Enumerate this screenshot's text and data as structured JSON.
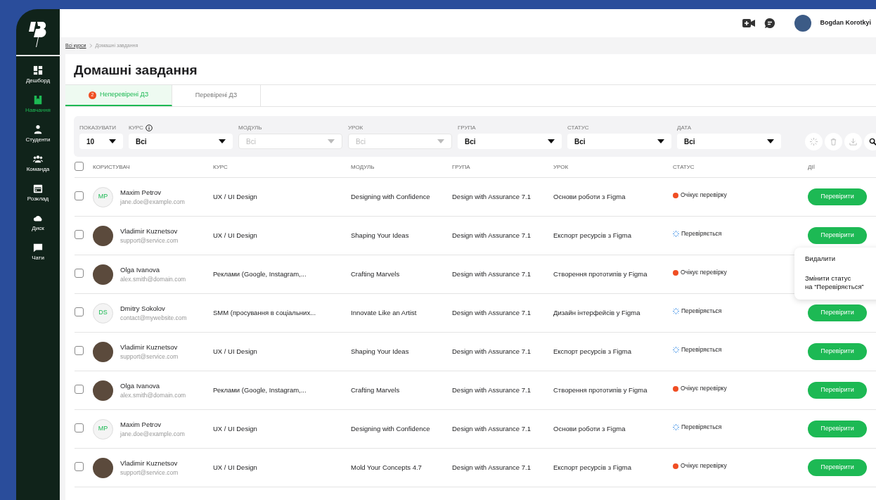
{
  "sidebar": {
    "items": [
      {
        "label": "Дешборд",
        "selected": false
      },
      {
        "label": "Навчання",
        "selected": true
      },
      {
        "label": "Студенти",
        "selected": false
      },
      {
        "label": "Команда",
        "selected": false
      },
      {
        "label": "Розклад",
        "selected": false
      },
      {
        "label": "Диск",
        "selected": false
      },
      {
        "label": "Чати",
        "selected": false
      }
    ]
  },
  "header": {
    "user_name": "Bogdan Korotkyi"
  },
  "breadcrumb": [
    "Всі курси",
    "Домашні завдання"
  ],
  "page_title": "Домашні завдання",
  "tabs": [
    {
      "label": "Неперевірені ДЗ",
      "badge": "2",
      "selected": true
    },
    {
      "label": "Перевірені ДЗ",
      "selected": false
    }
  ],
  "filters": [
    {
      "label": "ПОКАЗУВАТИ",
      "value": "10",
      "disabled": false,
      "info": false
    },
    {
      "label": "КУРС",
      "value": "Всі",
      "disabled": false,
      "info": true
    },
    {
      "label": "МОДУЛЬ",
      "value": "Всі",
      "disabled": true,
      "info": false
    },
    {
      "label": "УРОК",
      "value": "Всі",
      "disabled": true,
      "info": false
    },
    {
      "label": "ГРУПА",
      "value": "Всі",
      "disabled": false,
      "info": false
    },
    {
      "label": "СТАТУС",
      "value": "Всі",
      "disabled": false,
      "info": false
    },
    {
      "label": "ДАТА",
      "value": "Всі",
      "disabled": false,
      "info": false
    }
  ],
  "table": {
    "all_checked": false,
    "columns": [
      "КОРИСТУВАЧ",
      "КУРС",
      "МОДУЛЬ",
      "ГРУПА",
      "УРОК",
      "СТАТУС",
      "ДІЇ"
    ],
    "rows": [
      {
        "checked": false,
        "avatar": {
          "kind": "initials",
          "text": "MP"
        },
        "name": "Maxim Petrov",
        "email": "jane.doe@example.com",
        "course": "UX / UI Design",
        "module": "Designing with Confidence",
        "group": "Design with Assurance 7.1",
        "lesson": "Основи роботи з Figma",
        "status": {
          "kind": "pending",
          "text": "Очікує перевірку"
        },
        "action": "Перевірити"
      },
      {
        "checked": false,
        "avatar": {
          "kind": "photo"
        },
        "name": "Vladimir Kuznetsov",
        "email": "support@service.com",
        "course": "UX / UI Design",
        "module": "Shaping Your Ideas",
        "group": "Design with Assurance 7.1",
        "lesson": "Експорт ресурсів з Figma",
        "status": {
          "kind": "checking",
          "text": "Перевіряється"
        },
        "action": "Перевірити",
        "menu": [
          "Видалити",
          "Змінити статус\nна “Перевіряється”"
        ]
      },
      {
        "checked": false,
        "avatar": {
          "kind": "photo"
        },
        "name": "Olga Ivanova",
        "email": "alex.smith@domain.com",
        "course": "Реклами (Google, Instagram,...",
        "module": "Crafting Marvels",
        "group": "Design with Assurance 7.1",
        "lesson": "Створення прототипів у Figma",
        "status": {
          "kind": "pending",
          "text": "Очікує перевірку"
        }
      },
      {
        "checked": false,
        "avatar": {
          "kind": "initials",
          "text": "DS"
        },
        "name": "Dmitry Sokolov",
        "email": "contact@mywebsite.com",
        "course": "SMM (просування в соціальних...",
        "module": "Innovate Like an Artist",
        "group": "Design with Assurance 7.1",
        "lesson": "Дизайн інтерфейсів у Figma",
        "status": {
          "kind": "checking",
          "text": "Перевіряється"
        },
        "action": "Перевірити"
      },
      {
        "checked": false,
        "avatar": {
          "kind": "photo"
        },
        "name": "Vladimir Kuznetsov",
        "email": "support@service.com",
        "course": "UX / UI Design",
        "module": "Shaping Your Ideas",
        "group": "Design with Assurance 7.1",
        "lesson": "Експорт ресурсів з Figma",
        "status": {
          "kind": "checking",
          "text": "Перевіряється"
        },
        "action": "Перевірити"
      },
      {
        "checked": false,
        "avatar": {
          "kind": "photo"
        },
        "name": "Olga Ivanova",
        "email": "alex.smith@domain.com",
        "course": "Реклами (Google, Instagram,...",
        "module": "Crafting Marvels",
        "group": "Design with Assurance 7.1",
        "lesson": "Створення прототипів у Figma",
        "status": {
          "kind": "pending",
          "text": "Очікує перевірку"
        },
        "action": "Перевірити"
      },
      {
        "checked": false,
        "avatar": {
          "kind": "initials",
          "text": "MP"
        },
        "name": "Maxim Petrov",
        "email": "jane.doe@example.com",
        "course": "UX / UI Design",
        "module": "Designing with Confidence",
        "group": "Design with Assurance 7.1",
        "lesson": "Основи роботи з Figma",
        "status": {
          "kind": "checking",
          "text": "Перевіряється"
        },
        "action": "Перевірити"
      },
      {
        "checked": false,
        "avatar": {
          "kind": "photo"
        },
        "name": "Vladimir Kuznetsov",
        "email": "support@service.com",
        "course": "UX / UI Design",
        "module": "Mold Your Concepts 4.7",
        "group": "Design with Assurance 7.1",
        "lesson": "Експорт ресурсів з Figma",
        "status": {
          "kind": "pending",
          "text": "Очікує перевірку"
        },
        "action": "Перевірити"
      }
    ]
  }
}
